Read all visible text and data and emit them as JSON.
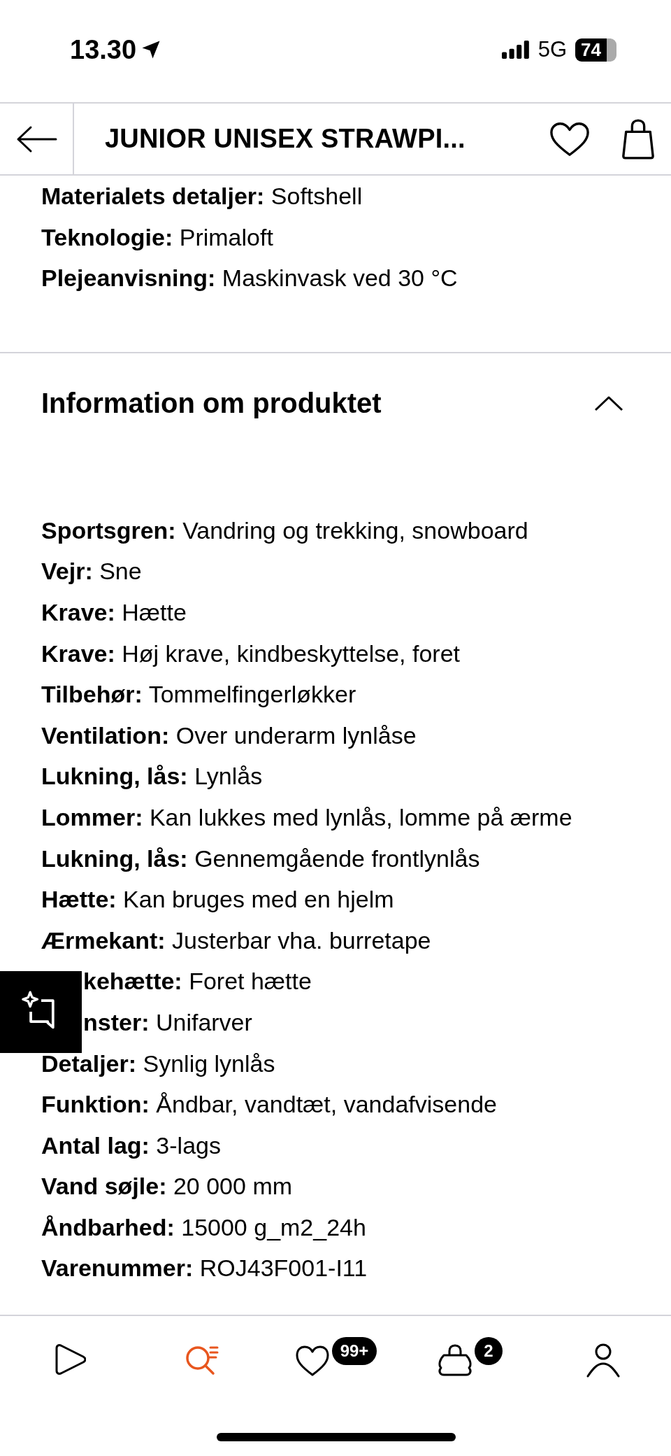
{
  "status_bar": {
    "time": "13.30",
    "network": "5G",
    "battery": "74"
  },
  "header": {
    "title": "JUNIOR UNISEX STRAWPI..."
  },
  "material_specs": [
    {
      "label": "Materialets detaljer:",
      "value": "Softshell",
      "kind": "full"
    },
    {
      "label": "Teknologie:",
      "value": "Primaloft",
      "kind": "full"
    },
    {
      "label": "Plejeanvisning:",
      "value": "Maskinvask ved 30 °C",
      "kind": "full"
    }
  ],
  "product_info": {
    "title": "Information om produktet",
    "expanded": true,
    "specs": [
      {
        "label": "Sportsgren:",
        "value": "Vandring og trekking, snowboard",
        "kind": "full"
      },
      {
        "label": "Vejr:",
        "value": "Sne",
        "kind": "full"
      },
      {
        "label": "Krave:",
        "value": "Hætte",
        "kind": "full"
      },
      {
        "label": "Krave:",
        "value": "Høj krave, kindbeskyttelse, foret",
        "kind": "full"
      },
      {
        "label": "Tilbehør:",
        "value": "Tommelfingerløkker",
        "kind": "full"
      },
      {
        "label": "Ventilation:",
        "value": "Over underarm lynlåse",
        "kind": "full"
      },
      {
        "label": "Lukning, lås:",
        "value": "Lynlås",
        "kind": "full"
      },
      {
        "label": "Lommer:",
        "value": "Kan lukkes med lynlås, lomme på ærme",
        "kind": "full"
      },
      {
        "label": "Lukning, lås:",
        "value": "Gennemgående frontlynlås",
        "kind": "full"
      },
      {
        "label": "Hætte:",
        "value": "Kan bruges med en hjelm",
        "kind": "full"
      },
      {
        "label": "Ærmekant:",
        "value": "Justerbar vha. burretape",
        "kind": "full"
      },
      {
        "label": "kehætte:",
        "value": "Foret hætte",
        "kind": "covered"
      },
      {
        "label": "nster:",
        "value": "Unifarver",
        "kind": "covered"
      },
      {
        "label": "Detaljer:",
        "value": "Synlig lynlås",
        "kind": "full"
      },
      {
        "label": "Funktion:",
        "value": "Åndbar, vandtæt, vandafvisende",
        "kind": "full"
      },
      {
        "label": "Antal lag:",
        "value": "3-lags",
        "kind": "full"
      },
      {
        "label": "Vand søjle:",
        "value": "20 000 mm",
        "kind": "full"
      },
      {
        "label": "Åndbarhed:",
        "value": "15000 g_m2_24h",
        "kind": "full"
      },
      {
        "label": "Varenummer:",
        "value": "ROJ43F001-I11",
        "kind": "full"
      }
    ]
  },
  "bottom_nav": [
    {
      "kind": "home",
      "selected": false
    },
    {
      "kind": "search",
      "selected": true
    },
    {
      "kind": "wishlist",
      "selected": false,
      "badge": "99+"
    },
    {
      "kind": "bag",
      "selected": false,
      "badge": "2"
    },
    {
      "kind": "account",
      "selected": false
    }
  ]
}
